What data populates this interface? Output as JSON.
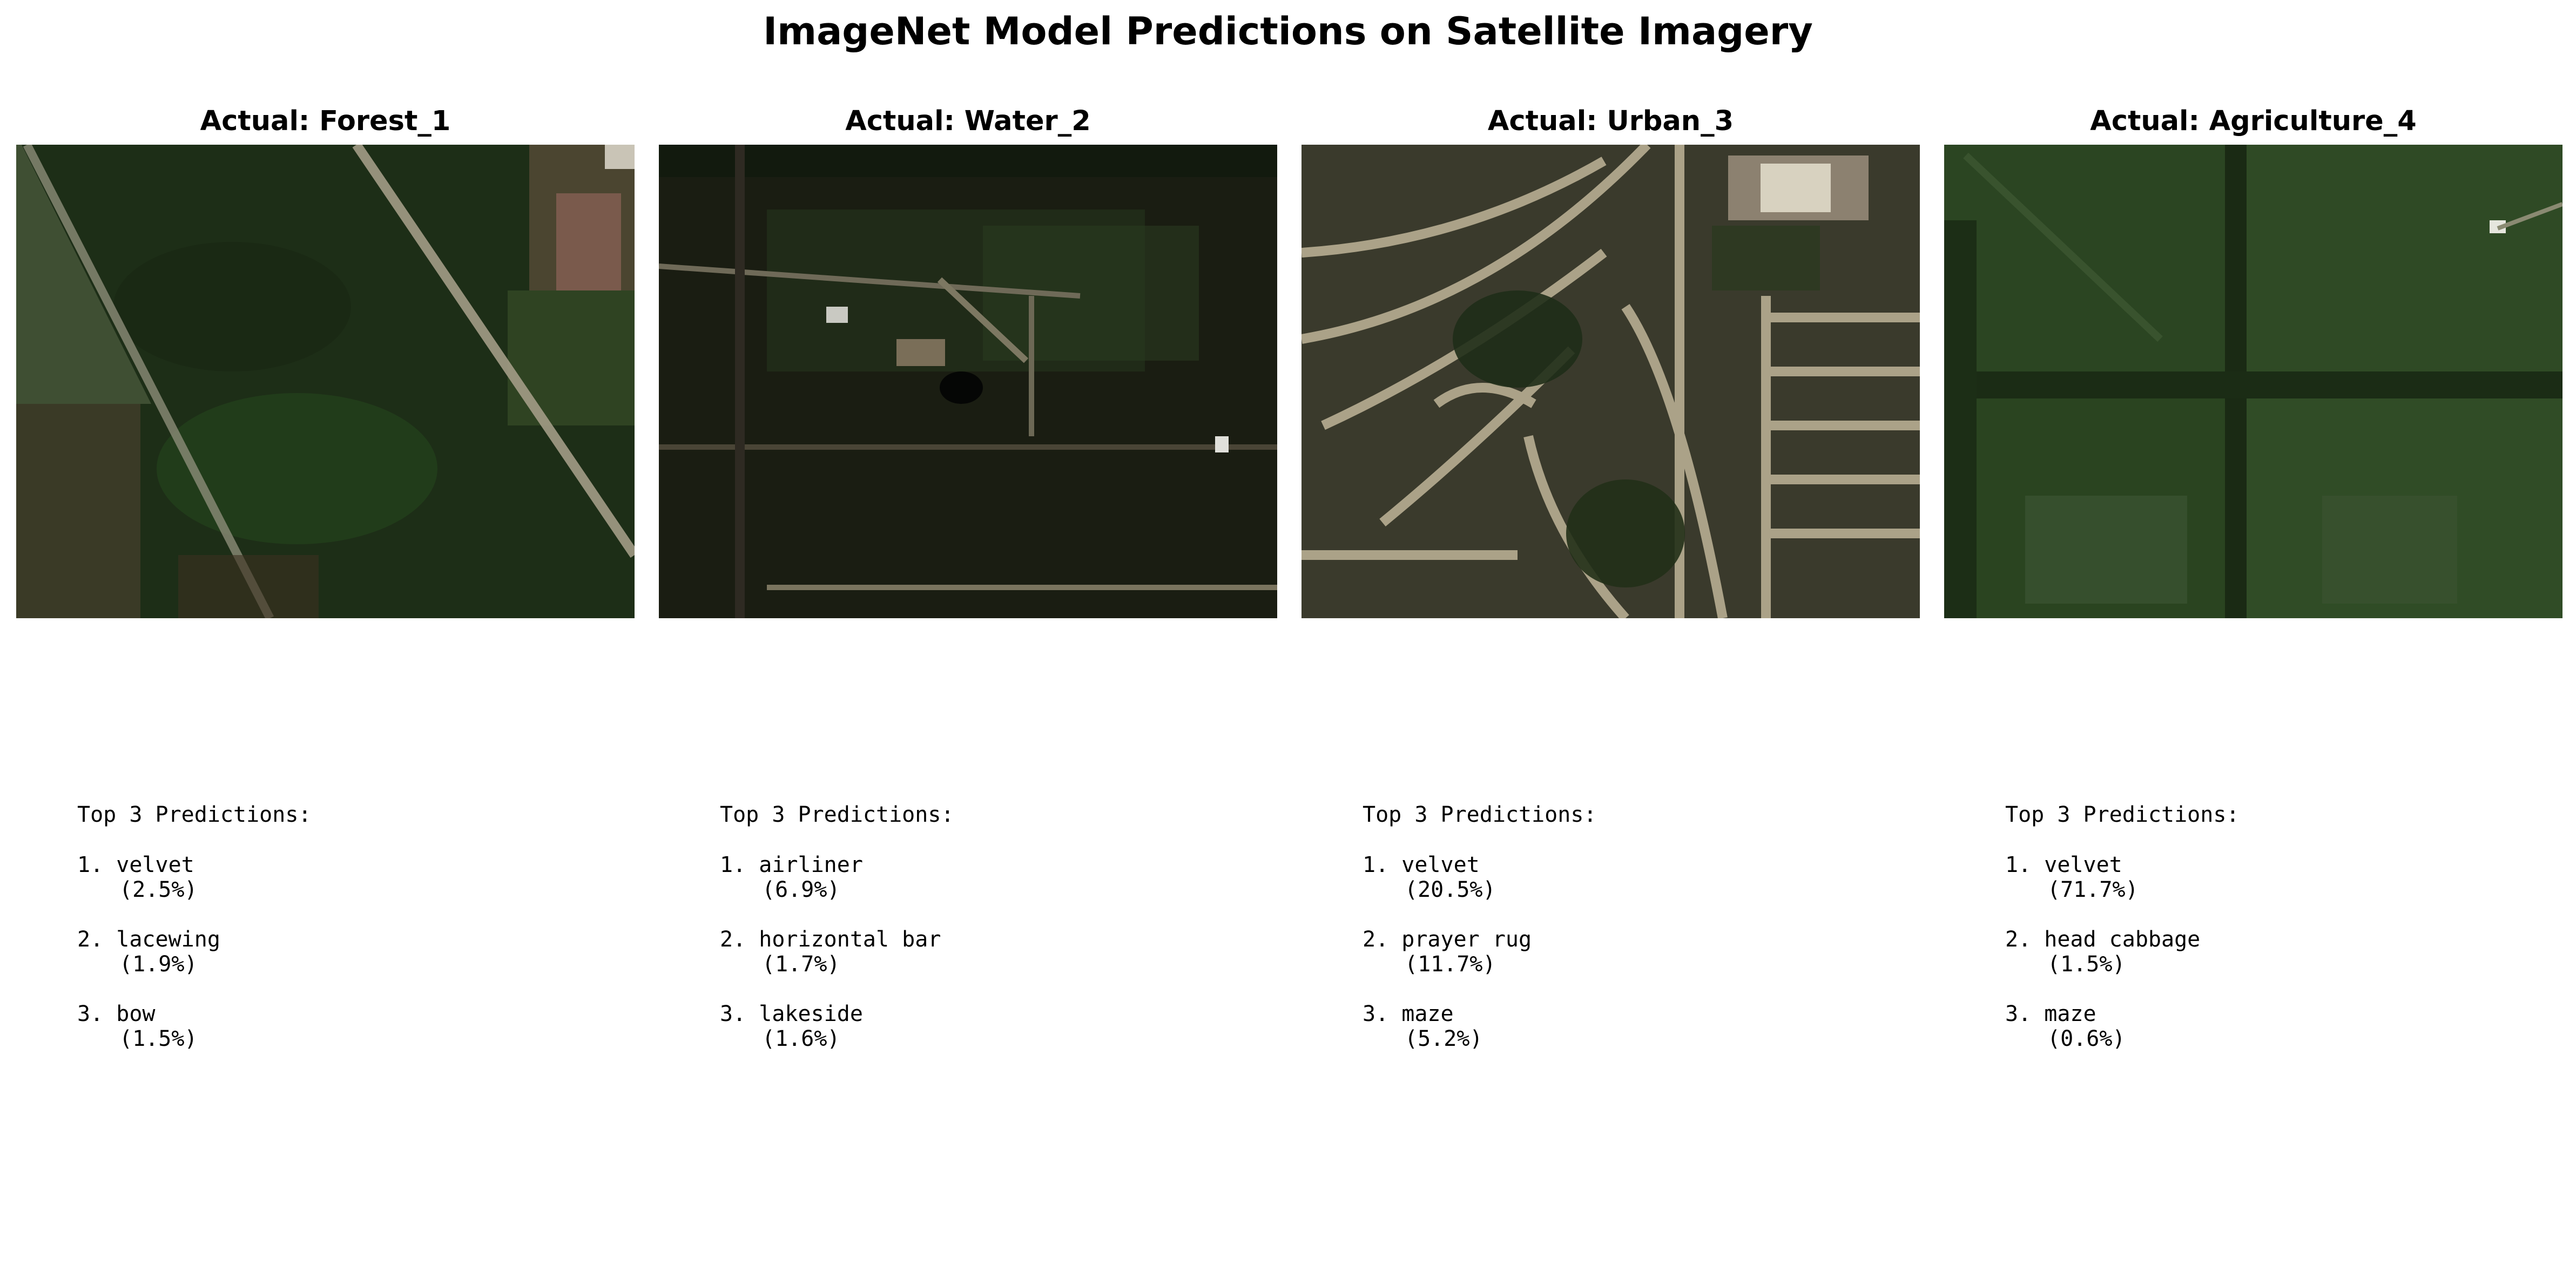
{
  "figure": {
    "title": "ImageNet Model Predictions on Satellite Imagery"
  },
  "panels": [
    {
      "title": "Actual: Forest_1",
      "image": "forest-satellite-tile",
      "predictions_header": "Top 3 Predictions:",
      "predictions": [
        {
          "rank": "1.",
          "label": "velvet",
          "prob": "(2.5%)"
        },
        {
          "rank": "2.",
          "label": "lacewing",
          "prob": "(1.9%)"
        },
        {
          "rank": "3.",
          "label": "bow",
          "prob": "(1.5%)"
        }
      ]
    },
    {
      "title": "Actual: Water_2",
      "image": "water-satellite-tile",
      "predictions_header": "Top 3 Predictions:",
      "predictions": [
        {
          "rank": "1.",
          "label": "airliner",
          "prob": "(6.9%)"
        },
        {
          "rank": "2.",
          "label": "horizontal bar",
          "prob": "(1.7%)"
        },
        {
          "rank": "3.",
          "label": "lakeside",
          "prob": "(1.6%)"
        }
      ]
    },
    {
      "title": "Actual: Urban_3",
      "image": "urban-satellite-tile",
      "predictions_header": "Top 3 Predictions:",
      "predictions": [
        {
          "rank": "1.",
          "label": "velvet",
          "prob": "(20.5%)"
        },
        {
          "rank": "2.",
          "label": "prayer rug",
          "prob": "(11.7%)"
        },
        {
          "rank": "3.",
          "label": "maze",
          "prob": "(5.2%)"
        }
      ]
    },
    {
      "title": "Actual: Agriculture_4",
      "image": "agriculture-satellite-tile",
      "predictions_header": "Top 3 Predictions:",
      "predictions": [
        {
          "rank": "1.",
          "label": "velvet",
          "prob": "(71.7%)"
        },
        {
          "rank": "2.",
          "label": "head cabbage",
          "prob": "(1.5%)"
        },
        {
          "rank": "3.",
          "label": "maze",
          "prob": "(0.6%)"
        }
      ]
    }
  ]
}
